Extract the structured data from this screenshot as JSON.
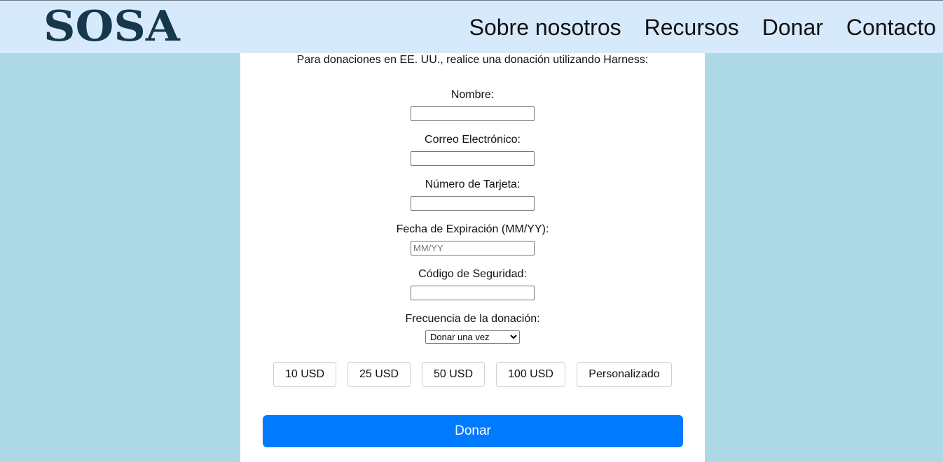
{
  "header": {
    "logo": "SOSA",
    "nav": [
      "Sobre nosotros",
      "Recursos",
      "Donar",
      "Contacto"
    ]
  },
  "form": {
    "intro": "Para donaciones en EE. UU., realice una donación utilizando Harness:",
    "name_label": "Nombre:",
    "name_value": "",
    "email_label": "Correo Electrónico:",
    "email_value": "",
    "card_label": "Número de Tarjeta:",
    "card_value": "",
    "expiry_label": "Fecha de Expiración (MM/YY):",
    "expiry_placeholder": "MM/YY",
    "cvc_label": "Código de Seguridad:",
    "cvc_value": "",
    "frequency_label": "Frecuencia de la donación:",
    "frequency_selected": "Donar una vez",
    "amounts": [
      "10 USD",
      "25 USD",
      "50 USD",
      "100 USD",
      "Personalizado"
    ],
    "submit_label": "Donar"
  },
  "colors": {
    "page_background": "#add8e6",
    "header_background": "#d6eafb",
    "logo": "#17374d",
    "primary_button": "#007bff"
  }
}
